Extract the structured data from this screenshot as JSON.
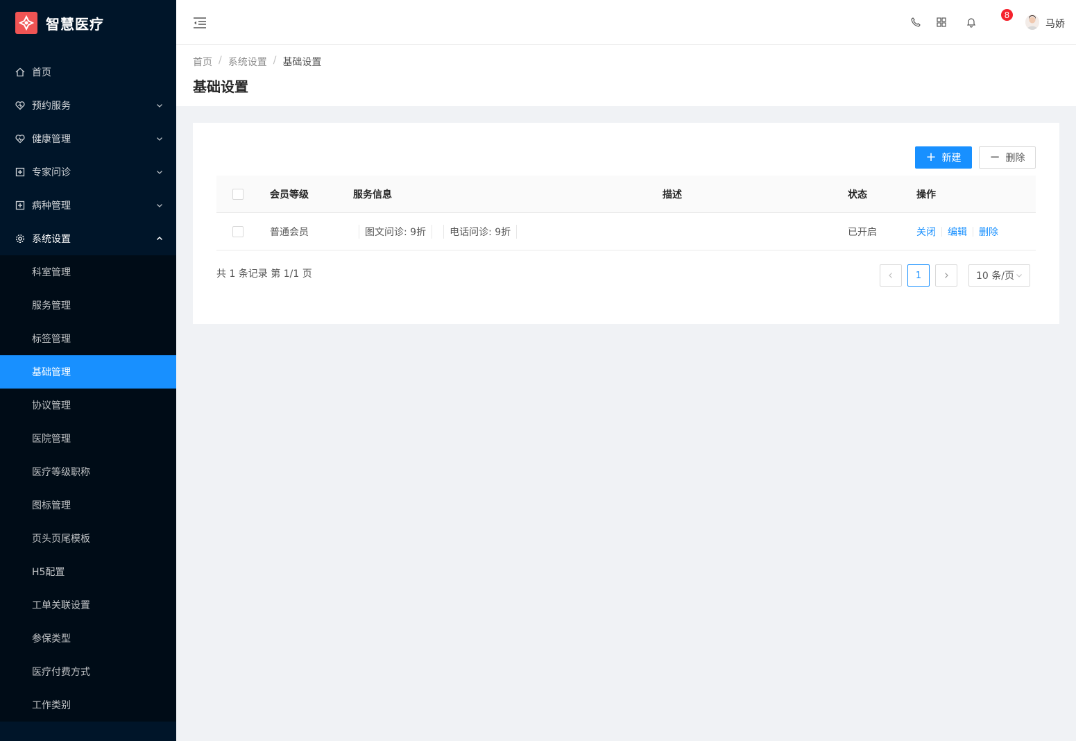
{
  "app": {
    "title": "智慧医疗"
  },
  "sidebar": {
    "items": [
      {
        "label": "首页",
        "icon": "home-icon"
      },
      {
        "label": "预约服务",
        "icon": "heart-icon"
      },
      {
        "label": "健康管理",
        "icon": "heart-pulse-icon"
      },
      {
        "label": "专家问诊",
        "icon": "medical-plus-icon"
      },
      {
        "label": "病种管理",
        "icon": "medical-plus-icon"
      },
      {
        "label": "系统设置",
        "icon": "gear-icon"
      }
    ],
    "submenu": [
      "科室管理",
      "服务管理",
      "标签管理",
      "基础管理",
      "协议管理",
      "医院管理",
      "医疗等级职称",
      "图标管理",
      "页头页尾模板",
      "H5配置",
      "工单关联设置",
      "参保类型",
      "医疗付费方式",
      "工作类别"
    ],
    "active_sub": "基础管理"
  },
  "header": {
    "notification_count": "8",
    "username": "马娇"
  },
  "breadcrumb": [
    "首页",
    "系统设置",
    "基础设置"
  ],
  "page": {
    "title": "基础设置"
  },
  "toolbar": {
    "new_label": "新建",
    "delete_label": "删除"
  },
  "table": {
    "columns": [
      "会员等级",
      "服务信息",
      "描述",
      "状态",
      "操作"
    ],
    "rows": [
      {
        "level": "普通会员",
        "services": [
          "图文问诊: 9折",
          "电话问诊: 9折"
        ],
        "description": "",
        "status": "已开启",
        "actions": [
          "关闭",
          "编辑",
          "删除"
        ]
      }
    ]
  },
  "pagination": {
    "summary": "共 1 条记录 第 1/1 页",
    "current_page": "1",
    "page_size": "10 条/页"
  },
  "colors": {
    "primary": "#1890ff",
    "sidebar": "#001529",
    "logo": "#f05454",
    "badge": "#f5222d"
  }
}
